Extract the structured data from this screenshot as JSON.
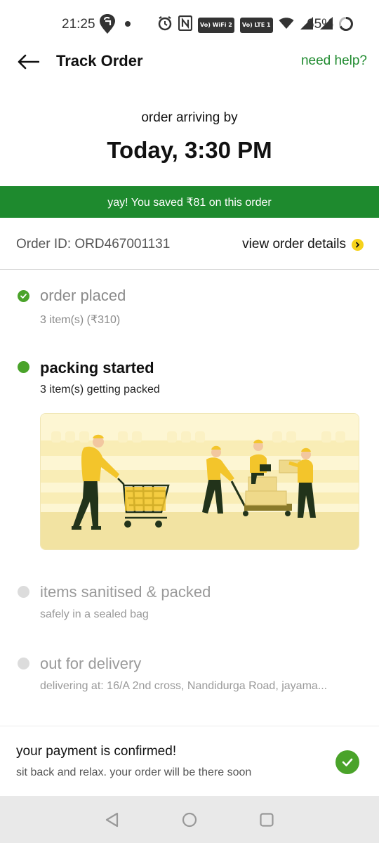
{
  "status_bar": {
    "time": "21:25",
    "network_badges": [
      "Vo) WiFi 2",
      "Vo) LTE 1"
    ],
    "battery": "65%"
  },
  "header": {
    "title": "Track Order",
    "help_link": "need help?"
  },
  "arrival": {
    "label": "order arriving by",
    "time": "Today, 3:30 PM"
  },
  "savings": {
    "text": "yay! You saved ₹81 on this order"
  },
  "order": {
    "id_text": "Order ID: ORD467001131",
    "view_details": "view order details"
  },
  "steps": [
    {
      "title": "order placed",
      "subtitle": "3 item(s) (₹310)",
      "state": "done"
    },
    {
      "title": "packing started",
      "subtitle": "3 item(s) getting packed",
      "state": "active"
    },
    {
      "title": "items sanitised & packed",
      "subtitle": "safely in a sealed bag",
      "state": "pending"
    },
    {
      "title": "out for delivery",
      "subtitle": "delivering at: 16/A 2nd cross, Nandidurga Road, jayama...",
      "state": "pending"
    }
  ],
  "payment": {
    "title": "your payment is confirmed!",
    "subtitle": "sit back and relax. your order will be there soon"
  },
  "colors": {
    "brand_green": "#1e8a2e",
    "step_done": "#4aa32a",
    "step_pending": "#dcdcdc",
    "accent_yellow": "#f6d21b"
  },
  "icons": {
    "back": "arrow-left-icon",
    "details": "chevron-right-icon",
    "step_done": "check-circle-icon",
    "payment": "check-circle-icon",
    "nav": [
      "back-triangle-icon",
      "home-circle-icon",
      "recents-square-icon"
    ]
  }
}
